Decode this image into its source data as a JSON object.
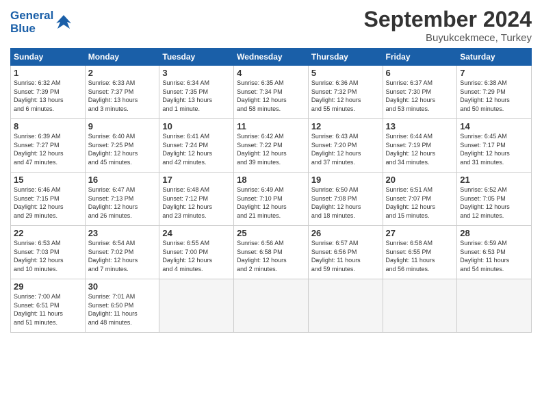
{
  "header": {
    "logo_line1": "General",
    "logo_line2": "Blue",
    "month": "September 2024",
    "location": "Buyukcekmece, Turkey"
  },
  "weekdays": [
    "Sunday",
    "Monday",
    "Tuesday",
    "Wednesday",
    "Thursday",
    "Friday",
    "Saturday"
  ],
  "days": [
    {
      "num": "",
      "info": ""
    },
    {
      "num": "",
      "info": ""
    },
    {
      "num": "",
      "info": ""
    },
    {
      "num": "1",
      "info": "Sunrise: 6:32 AM\nSunset: 7:39 PM\nDaylight: 13 hours\nand 6 minutes."
    },
    {
      "num": "2",
      "info": "Sunrise: 6:33 AM\nSunset: 7:37 PM\nDaylight: 13 hours\nand 3 minutes."
    },
    {
      "num": "3",
      "info": "Sunrise: 6:34 AM\nSunset: 7:35 PM\nDaylight: 13 hours\nand 1 minute."
    },
    {
      "num": "4",
      "info": "Sunrise: 6:35 AM\nSunset: 7:34 PM\nDaylight: 12 hours\nand 58 minutes."
    },
    {
      "num": "5",
      "info": "Sunrise: 6:36 AM\nSunset: 7:32 PM\nDaylight: 12 hours\nand 55 minutes."
    },
    {
      "num": "6",
      "info": "Sunrise: 6:37 AM\nSunset: 7:30 PM\nDaylight: 12 hours\nand 53 minutes."
    },
    {
      "num": "7",
      "info": "Sunrise: 6:38 AM\nSunset: 7:29 PM\nDaylight: 12 hours\nand 50 minutes."
    },
    {
      "num": "8",
      "info": "Sunrise: 6:39 AM\nSunset: 7:27 PM\nDaylight: 12 hours\nand 47 minutes."
    },
    {
      "num": "9",
      "info": "Sunrise: 6:40 AM\nSunset: 7:25 PM\nDaylight: 12 hours\nand 45 minutes."
    },
    {
      "num": "10",
      "info": "Sunrise: 6:41 AM\nSunset: 7:24 PM\nDaylight: 12 hours\nand 42 minutes."
    },
    {
      "num": "11",
      "info": "Sunrise: 6:42 AM\nSunset: 7:22 PM\nDaylight: 12 hours\nand 39 minutes."
    },
    {
      "num": "12",
      "info": "Sunrise: 6:43 AM\nSunset: 7:20 PM\nDaylight: 12 hours\nand 37 minutes."
    },
    {
      "num": "13",
      "info": "Sunrise: 6:44 AM\nSunset: 7:19 PM\nDaylight: 12 hours\nand 34 minutes."
    },
    {
      "num": "14",
      "info": "Sunrise: 6:45 AM\nSunset: 7:17 PM\nDaylight: 12 hours\nand 31 minutes."
    },
    {
      "num": "15",
      "info": "Sunrise: 6:46 AM\nSunset: 7:15 PM\nDaylight: 12 hours\nand 29 minutes."
    },
    {
      "num": "16",
      "info": "Sunrise: 6:47 AM\nSunset: 7:13 PM\nDaylight: 12 hours\nand 26 minutes."
    },
    {
      "num": "17",
      "info": "Sunrise: 6:48 AM\nSunset: 7:12 PM\nDaylight: 12 hours\nand 23 minutes."
    },
    {
      "num": "18",
      "info": "Sunrise: 6:49 AM\nSunset: 7:10 PM\nDaylight: 12 hours\nand 21 minutes."
    },
    {
      "num": "19",
      "info": "Sunrise: 6:50 AM\nSunset: 7:08 PM\nDaylight: 12 hours\nand 18 minutes."
    },
    {
      "num": "20",
      "info": "Sunrise: 6:51 AM\nSunset: 7:07 PM\nDaylight: 12 hours\nand 15 minutes."
    },
    {
      "num": "21",
      "info": "Sunrise: 6:52 AM\nSunset: 7:05 PM\nDaylight: 12 hours\nand 12 minutes."
    },
    {
      "num": "22",
      "info": "Sunrise: 6:53 AM\nSunset: 7:03 PM\nDaylight: 12 hours\nand 10 minutes."
    },
    {
      "num": "23",
      "info": "Sunrise: 6:54 AM\nSunset: 7:02 PM\nDaylight: 12 hours\nand 7 minutes."
    },
    {
      "num": "24",
      "info": "Sunrise: 6:55 AM\nSunset: 7:00 PM\nDaylight: 12 hours\nand 4 minutes."
    },
    {
      "num": "25",
      "info": "Sunrise: 6:56 AM\nSunset: 6:58 PM\nDaylight: 12 hours\nand 2 minutes."
    },
    {
      "num": "26",
      "info": "Sunrise: 6:57 AM\nSunset: 6:56 PM\nDaylight: 11 hours\nand 59 minutes."
    },
    {
      "num": "27",
      "info": "Sunrise: 6:58 AM\nSunset: 6:55 PM\nDaylight: 11 hours\nand 56 minutes."
    },
    {
      "num": "28",
      "info": "Sunrise: 6:59 AM\nSunset: 6:53 PM\nDaylight: 11 hours\nand 54 minutes."
    },
    {
      "num": "29",
      "info": "Sunrise: 7:00 AM\nSunset: 6:51 PM\nDaylight: 11 hours\nand 51 minutes."
    },
    {
      "num": "30",
      "info": "Sunrise: 7:01 AM\nSunset: 6:50 PM\nDaylight: 11 hours\nand 48 minutes."
    },
    {
      "num": "",
      "info": ""
    },
    {
      "num": "",
      "info": ""
    },
    {
      "num": "",
      "info": ""
    },
    {
      "num": "",
      "info": ""
    },
    {
      "num": "",
      "info": ""
    }
  ]
}
